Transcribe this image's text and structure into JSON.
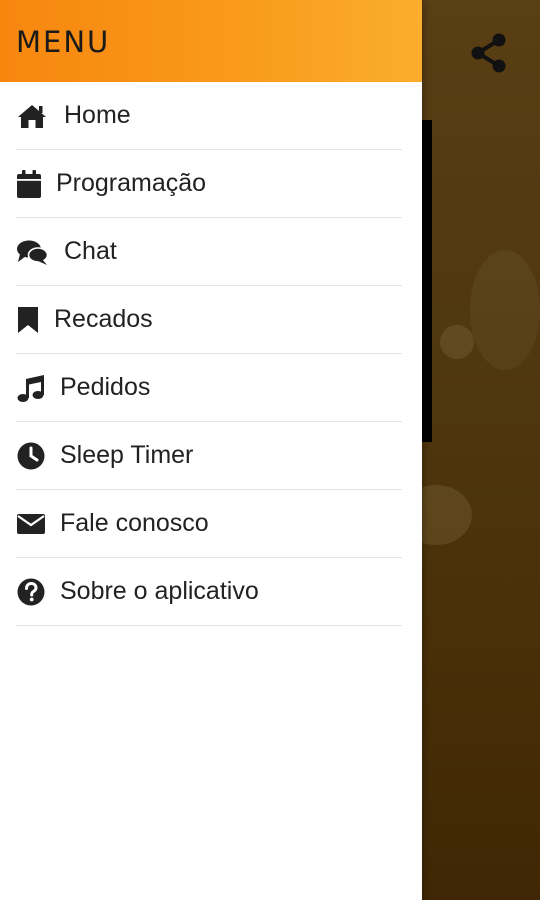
{
  "drawer": {
    "title": "MENU",
    "items": [
      {
        "label": "Home",
        "icon": "home-icon"
      },
      {
        "label": "Programação",
        "icon": "calendar-icon"
      },
      {
        "label": "Chat",
        "icon": "chat-bubbles-icon"
      },
      {
        "label": "Recados",
        "icon": "bookmark-icon"
      },
      {
        "label": "Pedidos",
        "icon": "music-note-icon"
      },
      {
        "label": "Sleep Timer",
        "icon": "clock-icon"
      },
      {
        "label": "Fale conosco",
        "icon": "envelope-icon"
      },
      {
        "label": "Sobre o aplicativo",
        "icon": "question-circle-icon"
      }
    ]
  },
  "app_bar": {
    "share_icon": "share-icon"
  },
  "colors": {
    "header_orange": "#f7860f",
    "header_orange_light": "#fbad2c",
    "background_brown": "#4f370f",
    "text": "#222222"
  }
}
